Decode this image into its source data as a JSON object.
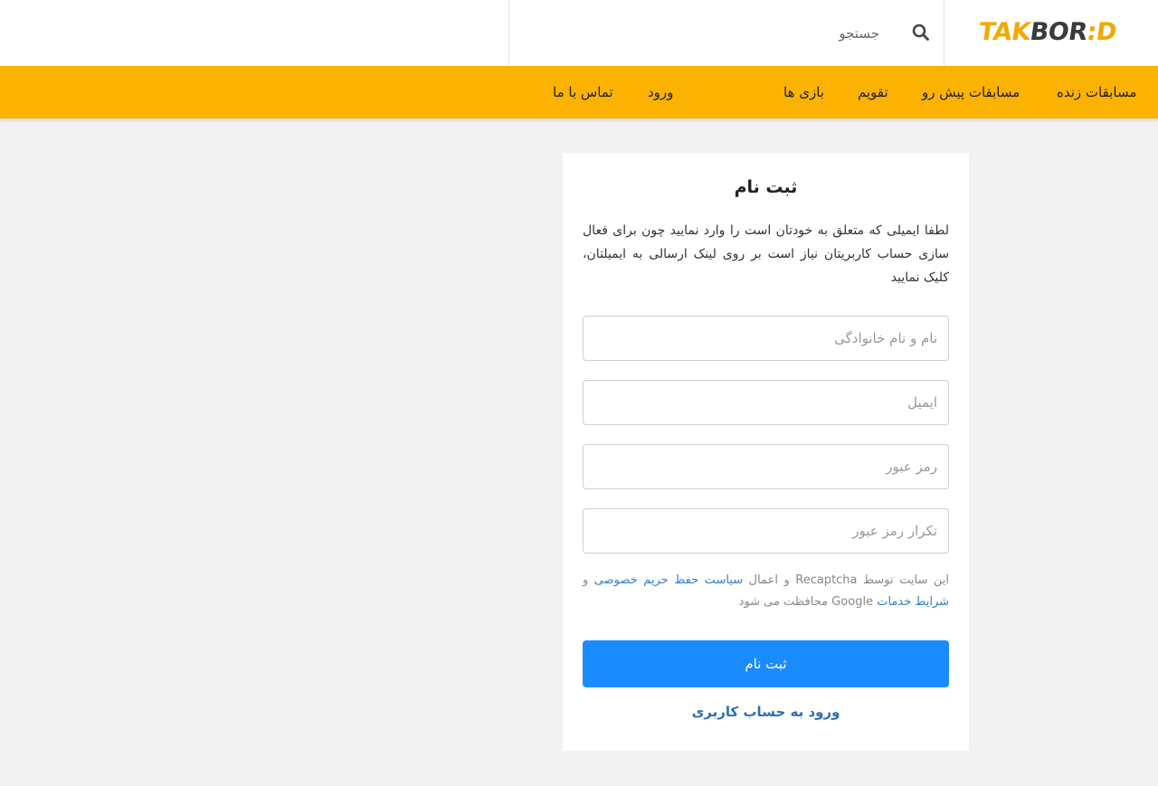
{
  "header": {
    "logo_part1": "TAK",
    "logo_part2": "BOR",
    "logo_part3": ":D",
    "search_placeholder": "جستجو",
    "search_icon": "search-icon"
  },
  "nav": {
    "items": [
      {
        "label": "مسابقات زنده"
      },
      {
        "label": "مسابقات پیش رو"
      },
      {
        "label": "تقویم"
      },
      {
        "label": "بازی ها"
      },
      {
        "label": "ورود"
      },
      {
        "label": "تماس با ما"
      }
    ]
  },
  "form": {
    "title": "ثبت نام",
    "description": "لطفا ایمیلی که متعلق به خودتان است را وارد نمایید چون برای فعال سازی حساب کاربریتان نیاز است بر روی لینک ارسالی به ایمیلتان، کلیک نمایید",
    "fullname_placeholder": "نام و نام خانوادگی",
    "email_placeholder": "ایمیل",
    "password_placeholder": "رمز عبور",
    "password_repeat_placeholder": "تکرار رمز عبور",
    "notice_part1": "این سایت توسط Recaptcha و اعمال ",
    "notice_link1": "سیاست حفظ حریم خصوصی",
    "notice_part2": " و ",
    "notice_link2": "شرایط خدمات",
    "notice_part3": " Google محافظت می شود",
    "submit_label": "ثبت نام",
    "login_link": "ورود به حساب کاربری"
  },
  "colors": {
    "brand_yellow": "#fbb200",
    "button_blue": "#1a8cff",
    "link_blue": "#2f7fd1"
  }
}
